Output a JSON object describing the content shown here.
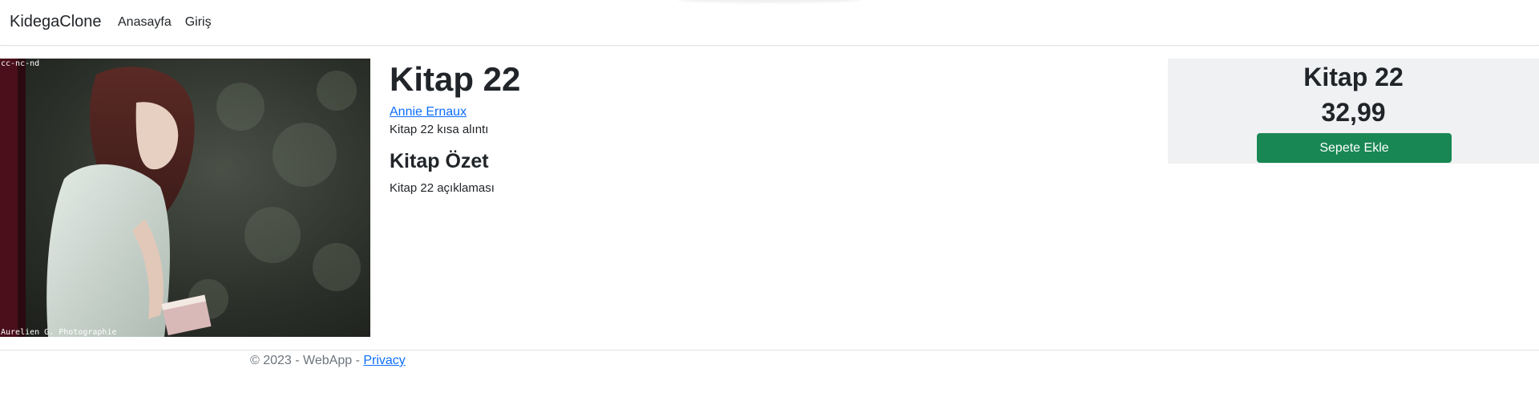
{
  "navbar": {
    "brand": "KidegaClone",
    "links": [
      "Anasayfa",
      "Giriş"
    ]
  },
  "image": {
    "caption_top": "cc-nc-nd",
    "caption_bottom": "Aurelien G. Photographie"
  },
  "book": {
    "title": "Kitap 22",
    "author": "Annie Ernaux",
    "excerpt": "Kitap 22 kısa alıntı",
    "summary_heading": "Kitap Özet",
    "summary_text": "Kitap 22 açıklaması"
  },
  "price_box": {
    "title": "Kitap 22",
    "price": "32,99",
    "button_label": "Sepete Ekle"
  },
  "footer": {
    "text": "© 2023 - WebApp - ",
    "privacy_label": "Privacy"
  },
  "colors": {
    "link": "#0d6efd",
    "button": "#198754",
    "price_box_bg": "#f0f1f3",
    "footer_text": "#6c757d"
  }
}
